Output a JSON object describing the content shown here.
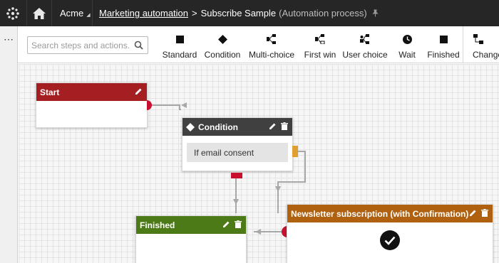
{
  "topbar": {
    "site_name": "Acme",
    "breadcrumb_link": "Marketing automation",
    "breadcrumb_separator": ">",
    "breadcrumb_current": "Subscribe Sample",
    "breadcrumb_type": "(Automation process)"
  },
  "search": {
    "placeholder": "Search steps and actions."
  },
  "toolbar": {
    "items": [
      {
        "label": "Standard",
        "icon": "square-icon"
      },
      {
        "label": "Condition",
        "icon": "diamond-icon"
      },
      {
        "label": "Multi-choice",
        "icon": "multi-choice-icon"
      },
      {
        "label": "First win",
        "icon": "first-win-icon"
      },
      {
        "label": "User choice",
        "icon": "user-choice-icon"
      },
      {
        "label": "Wait",
        "icon": "clock-icon"
      },
      {
        "label": "Finished",
        "icon": "square-icon"
      },
      {
        "label": "Change",
        "icon": "change-icon"
      }
    ]
  },
  "nodes": {
    "start": {
      "title": "Start",
      "color": "#a51f22"
    },
    "condition": {
      "title": "Condition",
      "body": "If email consent",
      "color": "#404040"
    },
    "finished": {
      "title": "Finished",
      "color": "#4b7a17"
    },
    "newsletter": {
      "title": "Newsletter subscription (with Confirmation)",
      "color": "#b06110"
    }
  },
  "colors": {
    "topbar_bg": "#262626",
    "port_red": "#c8102e",
    "port_orange": "#e0a030",
    "connector": "#a8a8a8"
  }
}
